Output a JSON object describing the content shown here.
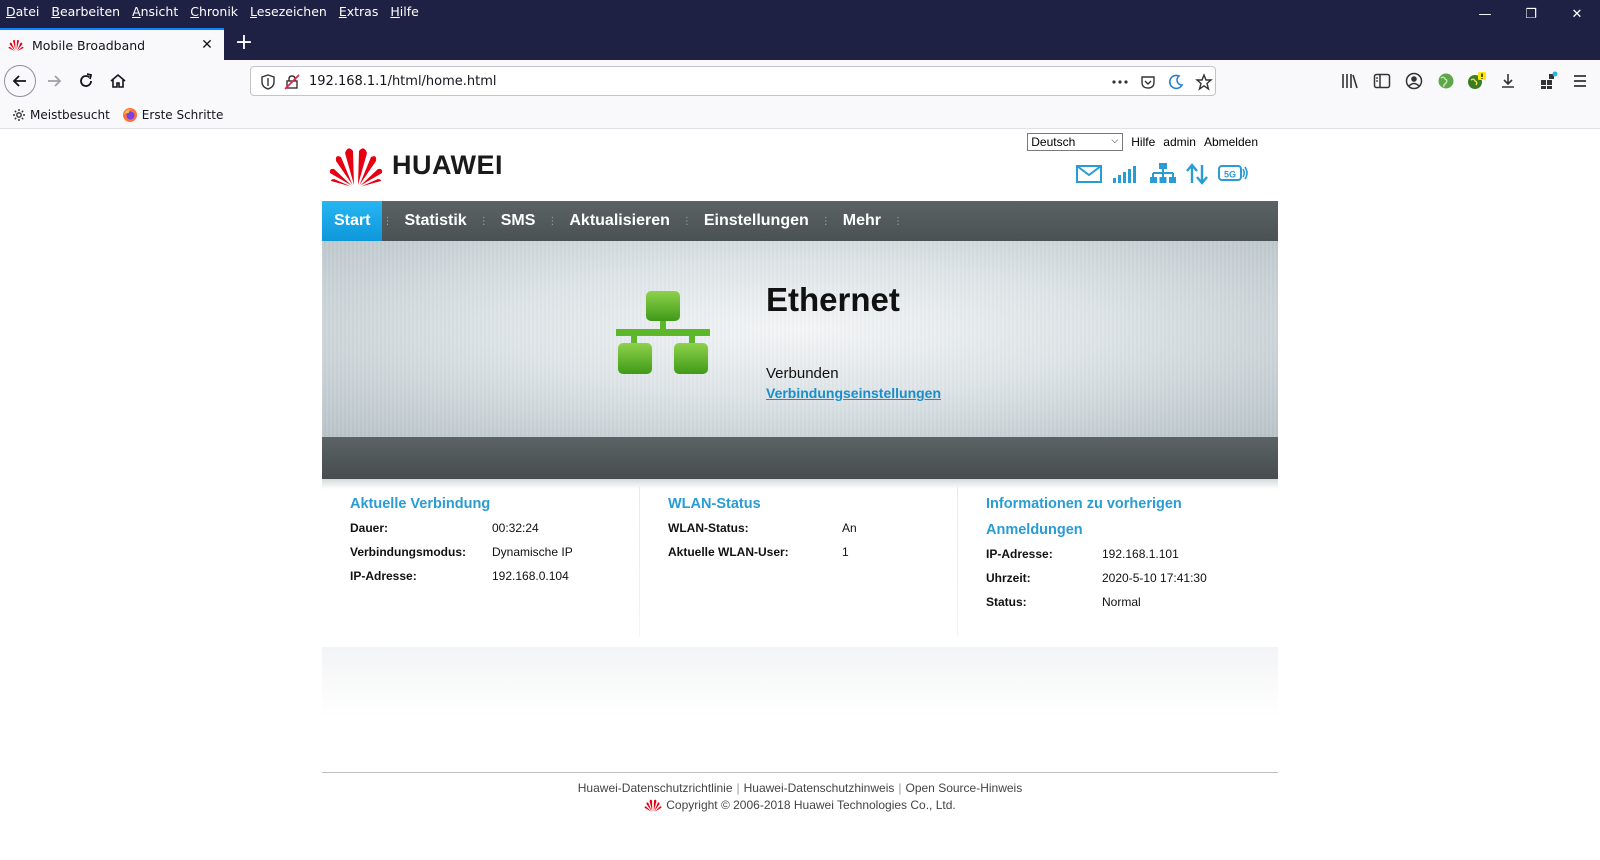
{
  "browser": {
    "menu": [
      "Datei",
      "Bearbeiten",
      "Ansicht",
      "Chronik",
      "Lesezeichen",
      "Extras",
      "Hilfe"
    ],
    "tab_title": "Mobile Broadband",
    "tab_close": "✕",
    "new_tab": "+",
    "url": "192.168.1.1/html/home.html",
    "window_controls": [
      "—",
      "❐",
      "✕"
    ],
    "bookmarks": [
      "Meistbesucht",
      "Erste Schritte"
    ]
  },
  "header": {
    "brand": "HUAWEI",
    "language": "Deutsch",
    "links": [
      "Hilfe",
      "admin",
      "Abmelden"
    ],
    "status_icons": [
      "mail-icon",
      "signal-icon",
      "network-icon",
      "transfer-icon",
      "5g-icon"
    ]
  },
  "nav": {
    "items": [
      "Start",
      "Statistik",
      "SMS",
      "Aktualisieren",
      "Einstellungen",
      "Mehr"
    ],
    "active": "Start"
  },
  "banner": {
    "title": "Ethernet",
    "status": "Verbunden",
    "link": "Verbindungseinstellungen"
  },
  "current_connection": {
    "title": "Aktuelle Verbindung",
    "rows": [
      {
        "label": "Dauer:",
        "value": "00:32:24"
      },
      {
        "label": "Verbindungsmodus:",
        "value": "Dynamische IP"
      },
      {
        "label": "IP-Adresse:",
        "value": "192.168.0.104"
      }
    ]
  },
  "wlan": {
    "title": "WLAN-Status",
    "rows": [
      {
        "label": "WLAN-Status:",
        "value": "An"
      },
      {
        "label": "Aktuelle WLAN-User:",
        "value": "1"
      }
    ]
  },
  "previous_login": {
    "title_line1": "Informationen zu vorherigen",
    "title_line2": "Anmeldungen",
    "rows": [
      {
        "label": "IP-Adresse:",
        "value": "192.168.1.101"
      },
      {
        "label": "Uhrzeit:",
        "value": "2020-5-10 17:41:30"
      },
      {
        "label": "Status:",
        "value": "Normal"
      }
    ]
  },
  "footer": {
    "links": [
      "Huawei-Datenschutzrichtlinie",
      "Huawei-Datenschutzhinweis",
      "Open Source-Hinweis"
    ],
    "copyright": "Copyright © 2006-2018 Huawei Technologies Co., Ltd."
  },
  "colors": {
    "titlebar": "#1f2144",
    "accent": "#2a9cd4",
    "nav_bg": "#525a5c",
    "active_tab": "#1aa7e8",
    "ethernet_green": "#5cb82a",
    "huawei_red": "#e60012"
  }
}
